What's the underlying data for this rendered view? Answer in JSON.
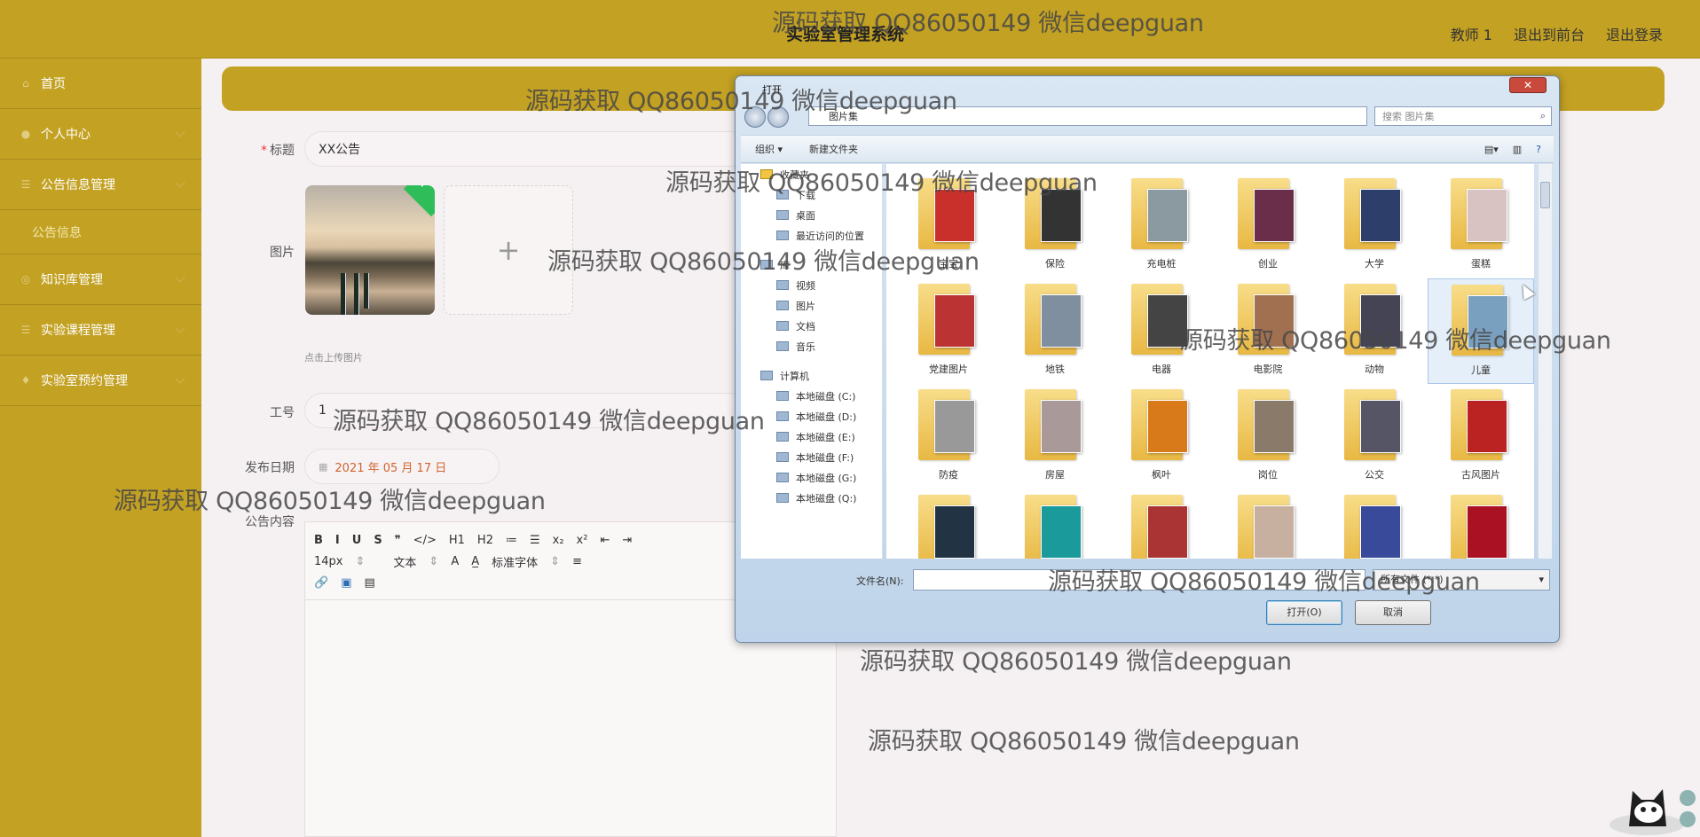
{
  "app": {
    "title": "实验室管理系统"
  },
  "topbar": {
    "user": "教师 1",
    "front_link": "退出到前台",
    "logout": "退出登录"
  },
  "sidebar": {
    "items": [
      {
        "label": "首页",
        "icon": "home-icon"
      },
      {
        "label": "个人中心",
        "icon": "user-icon"
      },
      {
        "label": "公告信息管理",
        "icon": "list-icon"
      },
      {
        "label": "公告信息",
        "icon": ""
      },
      {
        "label": "知识库管理",
        "icon": "globe-icon"
      },
      {
        "label": "实验课程管理",
        "icon": "list-icon"
      },
      {
        "label": "实验室预约管理",
        "icon": "bulb-icon"
      }
    ]
  },
  "form": {
    "title_label": "标题",
    "title_value": "XX公告",
    "image_label": "图片",
    "upload_hint": "点击上传图片",
    "job_no_label": "工号",
    "job_no_value": "1",
    "date_label": "发布日期",
    "date_value": "2021 年 05 月 17 日",
    "content_label": "公告内容"
  },
  "editor": {
    "row1": [
      "B",
      "I",
      "U",
      "S",
      "❞",
      "</>",
      "H1",
      "H2",
      "≔",
      "☰",
      "x₂",
      "x²",
      "⇤",
      "⇥"
    ],
    "font_size": "14px",
    "format": "文本",
    "font_family": "标准字体"
  },
  "dialog": {
    "title": "打开",
    "path": "图片集",
    "search_placeholder": "搜索 图片集",
    "organize": "组织 ▾",
    "new_folder": "新建文件夹",
    "favorites": "收藏夹",
    "tree": [
      {
        "label": "下载",
        "top": false
      },
      {
        "label": "桌面",
        "top": false
      },
      {
        "label": "最近访问的位置",
        "top": false
      },
      {
        "label": "库",
        "top": true
      },
      {
        "label": "视频",
        "top": false
      },
      {
        "label": "图片",
        "top": false
      },
      {
        "label": "文档",
        "top": false
      },
      {
        "label": "音乐",
        "top": false
      },
      {
        "label": "计算机",
        "top": true
      },
      {
        "label": "本地磁盘 (C:)",
        "top": false
      },
      {
        "label": "本地磁盘 (D:)",
        "top": false
      },
      {
        "label": "本地磁盘 (E:)",
        "top": false
      },
      {
        "label": "本地磁盘 (F:)",
        "top": false
      },
      {
        "label": "本地磁盘 (G:)",
        "top": false
      },
      {
        "label": "本地磁盘 (Q:)",
        "top": false
      }
    ],
    "folders": [
      "宝宝",
      "保险",
      "充电桩",
      "创业",
      "大学",
      "蛋糕",
      "党建图片",
      "地铁",
      "电器",
      "电影院",
      "动物",
      "儿童",
      "防疫",
      "房屋",
      "枫叶",
      "岗位",
      "公交",
      "古风图片",
      "",
      "",
      "",
      "",
      "",
      ""
    ],
    "filename_label": "文件名(N):",
    "filetype": "所有文件 (*.*)",
    "open_button": "打开(O)",
    "cancel_button": "取消"
  },
  "watermark": "源码获取 QQ86050149 微信deepguan",
  "colors": {
    "accent": "#c3a123",
    "date": "#d06530"
  }
}
